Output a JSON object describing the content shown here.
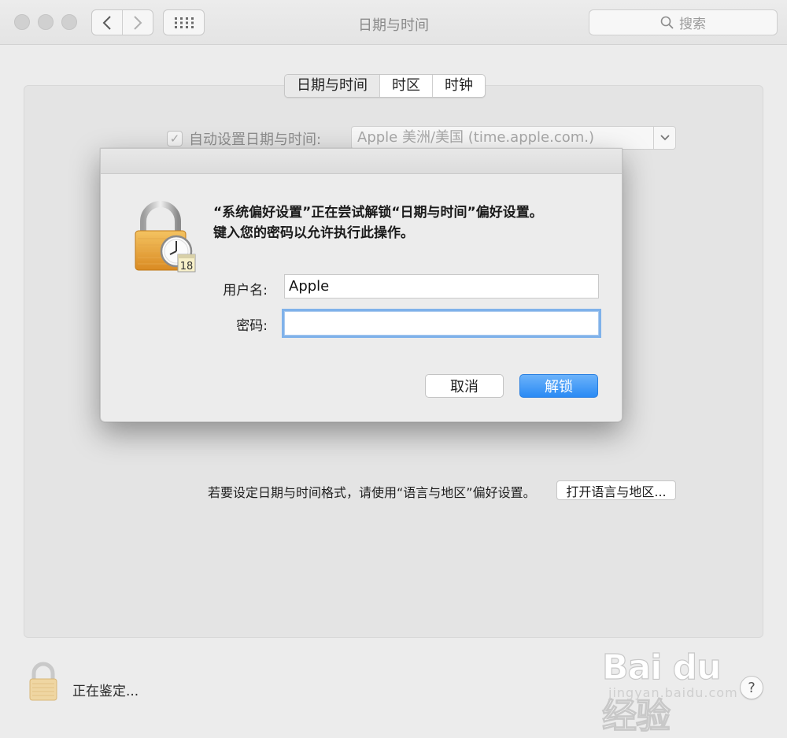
{
  "window": {
    "title": "日期与时间",
    "search_placeholder": "搜索"
  },
  "tabs": [
    {
      "label": "日期与时间",
      "active": true
    },
    {
      "label": "时区",
      "active": false
    },
    {
      "label": "时钟",
      "active": false
    }
  ],
  "auto_set": {
    "checked": true,
    "check_glyph": "✓",
    "label": "自动设置日期与时间:",
    "server": "Apple 美洲/美国 (time.apple.com.)"
  },
  "format": {
    "note": "若要设定日期与时间格式，请使用“语言与地区”偏好设置。",
    "button": "打开语言与地区..."
  },
  "footer": {
    "status": "正在鉴定...",
    "help": "?"
  },
  "dialog": {
    "message_line1": "“系统偏好设置”正在尝试解锁“日期与时间”偏好设置。",
    "message_line2": "键入您的密码以允许执行此操作。",
    "username_label": "用户名:",
    "username_value": "Apple",
    "password_label": "密码:",
    "password_value": "",
    "cancel_label": "取消",
    "unlock_label": "解锁",
    "icon_day": "18"
  },
  "watermark": {
    "main": "Bai du 经验",
    "sub": "jingyan.baidu.com"
  },
  "colors": {
    "accent_blue": "#2a8af4",
    "focus_ring": "#7fb2ea",
    "lock_gold": "#e8a542"
  }
}
